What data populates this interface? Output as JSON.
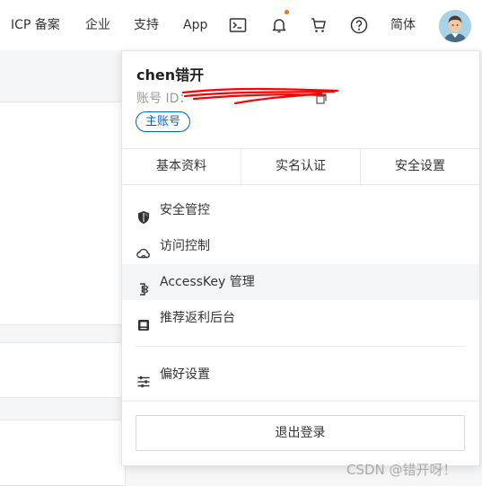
{
  "nav": {
    "icp": "ICP 备案",
    "enterprise": "企业",
    "support": "支持",
    "app": "App",
    "language": "简体",
    "icons": [
      "terminal-icon",
      "bell-icon",
      "cart-icon",
      "help-icon"
    ],
    "notification_dot_color": "#ff6a00"
  },
  "account": {
    "name": "chen错开",
    "id_label": "账号 ID：",
    "badge": "主账号"
  },
  "tabs": [
    "基本资料",
    "实名认证",
    "安全设置"
  ],
  "menu": [
    {
      "label": "安全管控",
      "icon": "shield-icon"
    },
    {
      "label": "访问控制",
      "icon": "cloud-icon"
    },
    {
      "label": "AccessKey 管理",
      "icon": "key-icon"
    },
    {
      "label": "推荐返利后台",
      "icon": "referral-icon"
    }
  ],
  "preferences": {
    "label": "偏好设置",
    "icon": "sliders-icon"
  },
  "logout": "退出登录",
  "watermark": "CSDN @错开呀！",
  "colors": {
    "accent": "#0064c8",
    "redaction": "#ff0000"
  }
}
